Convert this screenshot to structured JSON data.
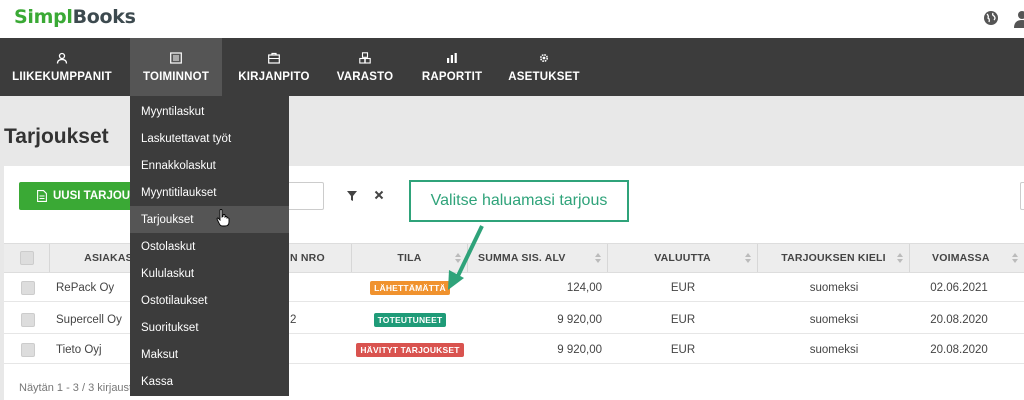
{
  "header": {
    "logo_part1": "Simpl",
    "logo_part2": "Books",
    "globe_icon": "globe-icon",
    "user_icon": "user-icon"
  },
  "nav": {
    "items": [
      {
        "label": "LIIKEKUMPPANIT",
        "icon": "user-icon"
      },
      {
        "label": "TOIMINNOT",
        "icon": "list-icon",
        "active": true
      },
      {
        "label": "KIRJANPITO",
        "icon": "briefcase-icon"
      },
      {
        "label": "VARASTO",
        "icon": "boxes-icon"
      },
      {
        "label": "RAPORTIT",
        "icon": "bar-chart-icon"
      },
      {
        "label": "ASETUKSET",
        "icon": "gear-icon"
      }
    ]
  },
  "dropdown": {
    "items": [
      {
        "label": "Myyntilaskut"
      },
      {
        "label": "Laskutettavat työt"
      },
      {
        "label": "Ennakkolaskut"
      },
      {
        "label": "Myyntitilaukset"
      },
      {
        "label": "Tarjoukset",
        "hover": true
      },
      {
        "label": "Ostolaskut"
      },
      {
        "label": "Kululaskut"
      },
      {
        "label": "Ostotilaukset"
      },
      {
        "label": "Suoritukset"
      },
      {
        "label": "Maksut"
      },
      {
        "label": "Kassa"
      }
    ]
  },
  "page": {
    "title": "Tarjoukset",
    "new_button": "UUSI TARJOUS",
    "footer": "Näytän 1 - 3 / 3 kirjausta"
  },
  "table": {
    "columns": [
      "",
      "ASIAKAS",
      "N NRO",
      "TILA",
      "SUMMA SIS. ALV",
      "VALUUTTA",
      "TARJOUKSEN KIELI",
      "VOIMASSA"
    ],
    "rows": [
      {
        "customer": "RePack Oy",
        "nro": "",
        "status": "LÄHETTÄMÄTTÄ",
        "status_color": "#f0922e",
        "sum": "124,00",
        "currency": "EUR",
        "language": "suomeksi",
        "valid": "02.06.2021"
      },
      {
        "customer": "Supercell Oy",
        "nro": "2",
        "status": "TOTEUTUNEET",
        "status_color": "#1f9b78",
        "sum": "9 920,00",
        "currency": "EUR",
        "language": "suomeksi",
        "valid": "20.08.2020"
      },
      {
        "customer": "Tieto Oyj",
        "nro": "",
        "status": "HÄVITYT TARJOUKSET",
        "status_color": "#d9534f",
        "sum": "9 920,00",
        "currency": "EUR",
        "language": "suomeksi",
        "valid": "20.08.2020"
      }
    ]
  },
  "callout": {
    "text": "Valitse haluamasi tarjous",
    "color": "#2fa37a"
  }
}
